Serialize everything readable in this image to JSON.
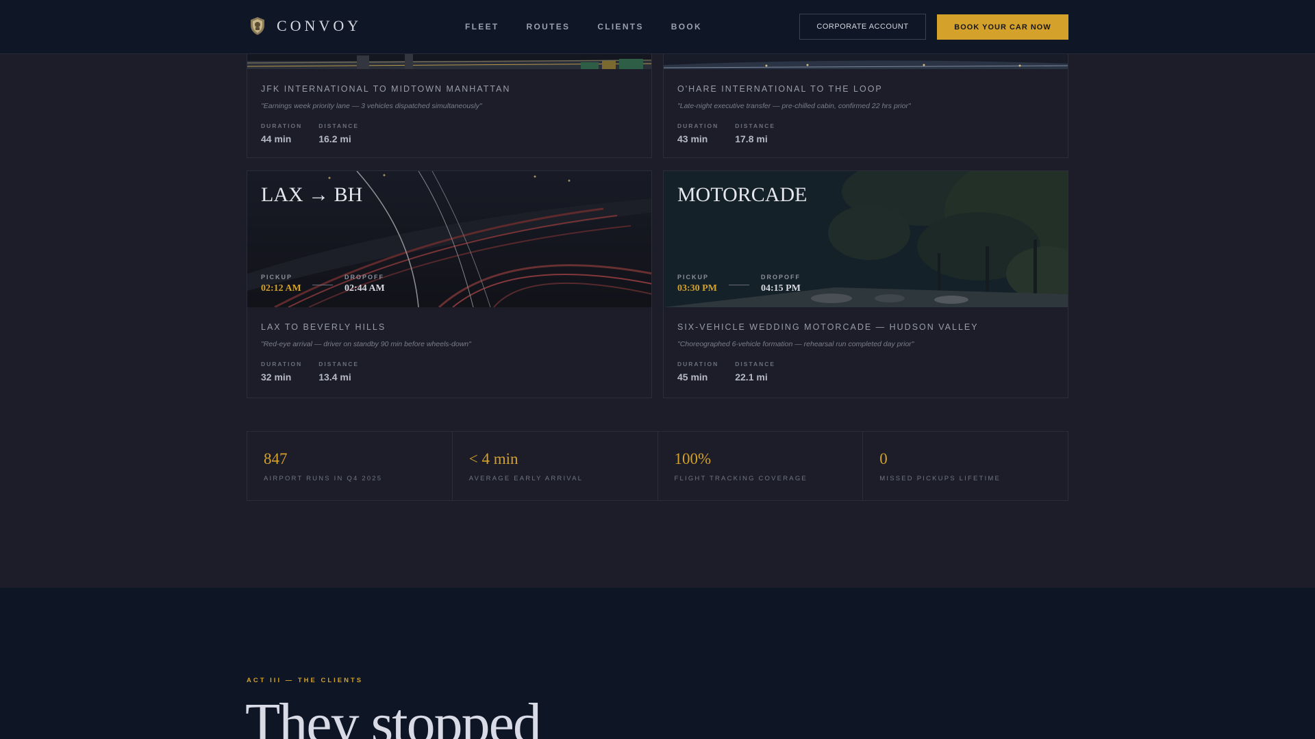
{
  "nav": {
    "brand": "CONVOY",
    "links": [
      "FLEET",
      "ROUTES",
      "CLIENTS",
      "BOOK"
    ],
    "corporate_label": "CORPORATE ACCOUNT",
    "book_label": "BOOK YOUR CAR NOW"
  },
  "cards": [
    {
      "route": "JFK INTERNATIONAL TO MIDTOWN MANHATTAN",
      "quote": "\"Earnings week priority lane — 3 vehicles dispatched simultaneously\"",
      "duration_label": "DURATION",
      "duration": "44 min",
      "distance_label": "DISTANCE",
      "distance": "16.2 mi"
    },
    {
      "route": "O'HARE INTERNATIONAL TO THE LOOP",
      "quote": "\"Late-night executive transfer — pre-chilled cabin, confirmed 22 hrs prior\"",
      "duration_label": "DURATION",
      "duration": "43 min",
      "distance_label": "DISTANCE",
      "distance": "17.8 mi"
    },
    {
      "title": "LAX → BH",
      "pickup_label": "PICKUP",
      "pickup": "02:12 AM",
      "dropoff_label": "DROPOFF",
      "dropoff": "02:44 AM",
      "route": "LAX TO BEVERLY HILLS",
      "quote": "\"Red-eye arrival — driver on standby 90 min before wheels-down\"",
      "duration_label": "DURATION",
      "duration": "32 min",
      "distance_label": "DISTANCE",
      "distance": "13.4 mi"
    },
    {
      "title": "MOTORCADE",
      "pickup_label": "PICKUP",
      "pickup": "03:30 PM",
      "dropoff_label": "DROPOFF",
      "dropoff": "04:15 PM",
      "route": "SIX-VEHICLE WEDDING MOTORCADE — HUDSON VALLEY",
      "quote": "\"Choreographed 6-vehicle formation — rehearsal run completed day prior\"",
      "duration_label": "DURATION",
      "duration": "45 min",
      "distance_label": "DISTANCE",
      "distance": "22.1 mi"
    }
  ],
  "metrics": [
    {
      "value": "847",
      "label": "AIRPORT RUNS IN Q4 2025"
    },
    {
      "value": "< 4 min",
      "label": "AVERAGE EARLY ARRIVAL"
    },
    {
      "value": "100%",
      "label": "FLIGHT TRACKING COVERAGE"
    },
    {
      "value": "0",
      "label": "MISSED PICKUPS LIFETIME"
    }
  ],
  "clients": {
    "act_label": "ACT III — THE CLIENTS",
    "headline": "They stopped"
  },
  "colors": {
    "accent": "#d4a12a",
    "background": "#1c1d29",
    "nav_bg": "#0f1626"
  },
  "icons": [
    "shield-logo-icon"
  ]
}
